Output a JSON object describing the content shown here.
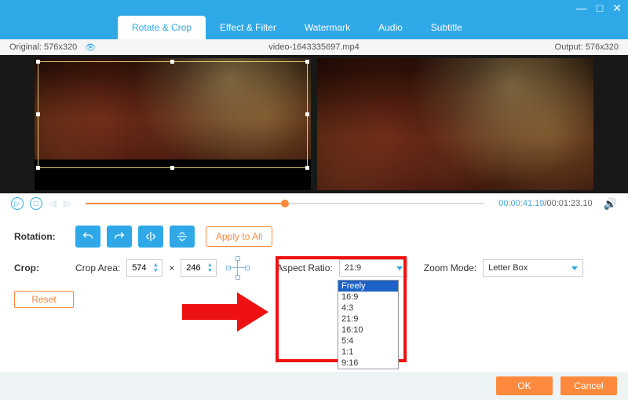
{
  "window": {
    "minimize": "—",
    "maximize": "□",
    "close": "✕"
  },
  "tabs": {
    "rotate_crop": "Rotate & Crop",
    "effect_filter": "Effect & Filter",
    "watermark": "Watermark",
    "audio": "Audio",
    "subtitle": "Subtitle"
  },
  "infobar": {
    "original_label": "Original: 576x320",
    "filename": "video-1643335697.mp4",
    "output_label": "Output: 576x320"
  },
  "playback": {
    "current": "00:00:41.19",
    "total": "/00:01:23.10",
    "progress_pct": 50
  },
  "rotation": {
    "label": "Rotation:",
    "apply_label": "Apply to All"
  },
  "crop": {
    "label": "Crop:",
    "area_label": "Crop Area:",
    "width": "574",
    "height": "246",
    "times": "×",
    "reset_label": "Reset"
  },
  "aspect": {
    "label": "Aspect Ratio:",
    "value": "21:9",
    "options": [
      "Freely",
      "16:9",
      "4:3",
      "21:9",
      "16:10",
      "5:4",
      "1:1",
      "9:16"
    ],
    "selected": "Freely"
  },
  "zoom": {
    "label": "Zoom Mode:",
    "value": "Letter Box"
  },
  "footer": {
    "ok": "OK",
    "cancel": "Cancel"
  }
}
